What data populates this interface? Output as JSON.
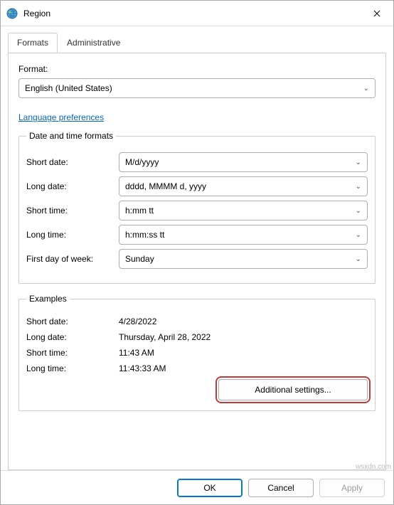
{
  "window": {
    "title": "Region"
  },
  "tabs": {
    "formats": "Formats",
    "administrative": "Administrative"
  },
  "format": {
    "label": "Format:",
    "value": "English (United States)"
  },
  "link_lang_prefs": "Language preferences",
  "group_dtf": {
    "legend": "Date and time formats",
    "short_date_label": "Short date:",
    "short_date_value": "M/d/yyyy",
    "long_date_label": "Long date:",
    "long_date_value": "dddd, MMMM d, yyyy",
    "short_time_label": "Short time:",
    "short_time_value": "h:mm tt",
    "long_time_label": "Long time:",
    "long_time_value": "h:mm:ss tt",
    "first_day_label": "First day of week:",
    "first_day_value": "Sunday"
  },
  "group_examples": {
    "legend": "Examples",
    "short_date_label": "Short date:",
    "short_date_value": "4/28/2022",
    "long_date_label": "Long date:",
    "long_date_value": "Thursday, April 28, 2022",
    "short_time_label": "Short time:",
    "short_time_value": "11:43 AM",
    "long_time_label": "Long time:",
    "long_time_value": "11:43:33 AM"
  },
  "additional_settings": "Additional settings...",
  "buttons": {
    "ok": "OK",
    "cancel": "Cancel",
    "apply": "Apply"
  },
  "watermark": "wsxdn.com"
}
